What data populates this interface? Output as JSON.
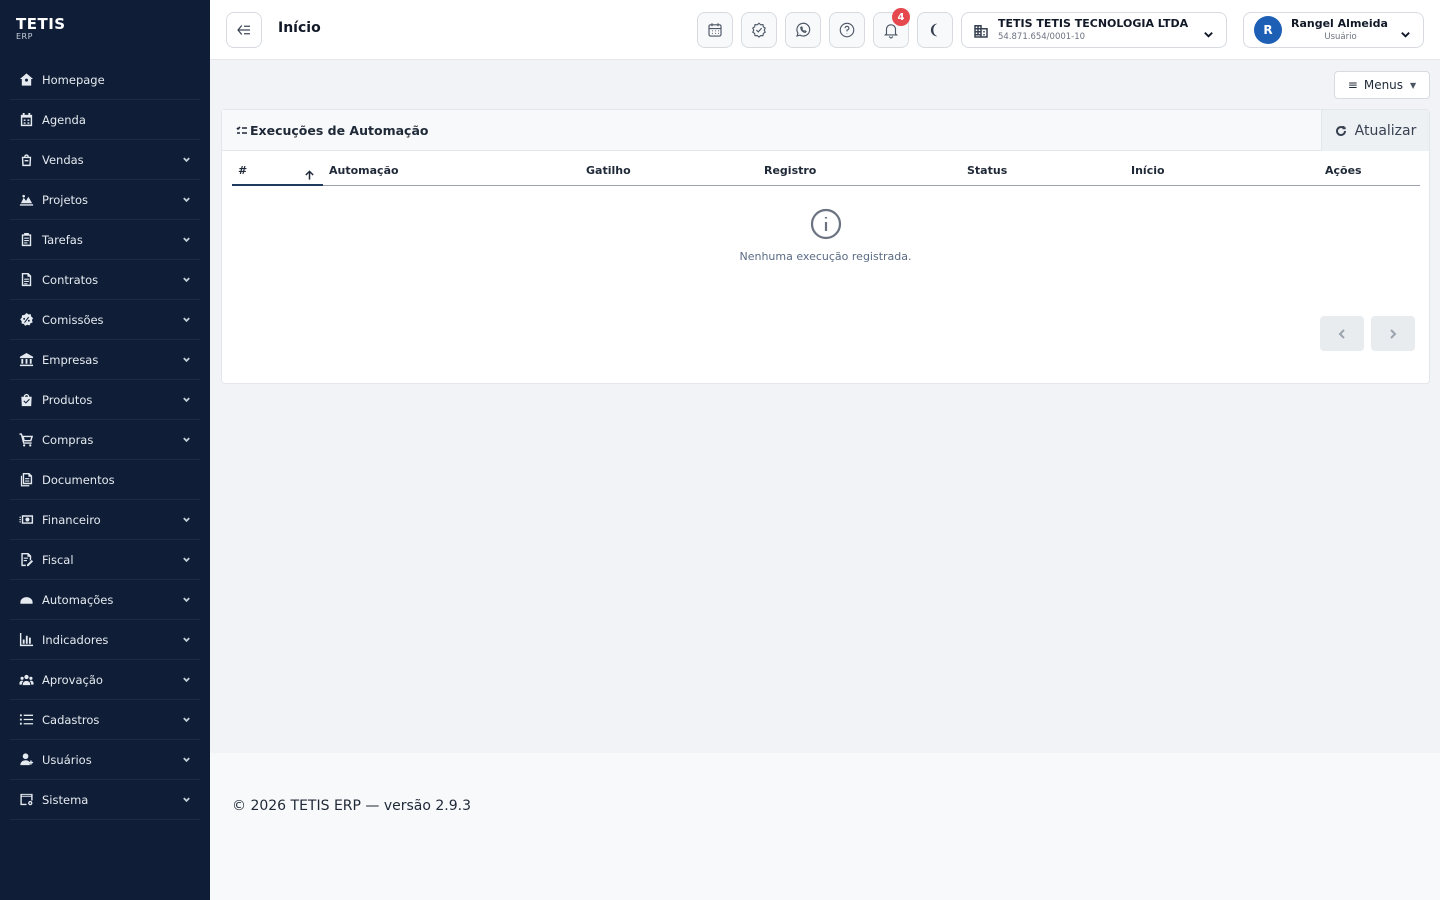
{
  "app": {
    "name": "TETIS",
    "subtitle": "ERP"
  },
  "sidebar": {
    "items": [
      {
        "label": "Homepage",
        "icon": "home-icon",
        "expandable": false
      },
      {
        "label": "Agenda",
        "icon": "calendar-icon",
        "expandable": false
      },
      {
        "label": "Vendas",
        "icon": "shopping-bag-icon",
        "expandable": true
      },
      {
        "label": "Projetos",
        "icon": "projects-icon",
        "expandable": true
      },
      {
        "label": "Tarefas",
        "icon": "clipboard-icon",
        "expandable": true
      },
      {
        "label": "Contratos",
        "icon": "document-icon",
        "expandable": true
      },
      {
        "label": "Comissões",
        "icon": "percent-badge-icon",
        "expandable": true
      },
      {
        "label": "Empresas",
        "icon": "bank-icon",
        "expandable": true
      },
      {
        "label": "Produtos",
        "icon": "product-bag-icon",
        "expandable": true
      },
      {
        "label": "Compras",
        "icon": "cart-icon",
        "expandable": true
      },
      {
        "label": "Documentos",
        "icon": "documents-icon",
        "expandable": false
      },
      {
        "label": "Financeiro",
        "icon": "money-icon",
        "expandable": true
      },
      {
        "label": "Fiscal",
        "icon": "fiscal-icon",
        "expandable": true
      },
      {
        "label": "Automações",
        "icon": "automation-icon",
        "expandable": true
      },
      {
        "label": "Indicadores",
        "icon": "chart-icon",
        "expandable": true
      },
      {
        "label": "Aprovação",
        "icon": "group-icon",
        "expandable": true
      },
      {
        "label": "Cadastros",
        "icon": "list-icon",
        "expandable": true
      },
      {
        "label": "Usuários",
        "icon": "user-icon",
        "expandable": true
      },
      {
        "label": "Sistema",
        "icon": "system-icon",
        "expandable": true
      }
    ]
  },
  "header": {
    "title": "Início",
    "notifications_count": "4",
    "company": {
      "name": "TETIS TETIS TECNOLOGIA LTDA",
      "cnpj": "54.871.654/0001-10"
    },
    "user": {
      "name": "Rangel Almeida",
      "role": "Usuário",
      "initial": "R"
    }
  },
  "toolbar": {
    "menus_label": "Menus"
  },
  "card": {
    "title": "Execuções de Automação",
    "refresh_label": "Atualizar",
    "columns": [
      "#",
      "Automação",
      "Gatilho",
      "Registro",
      "Status",
      "Início",
      "Ações"
    ],
    "empty_message": "Nenhuma execução registrada."
  },
  "footer": {
    "text": "© 2026 TETIS ERP — versão 2.9.3"
  },
  "colors": {
    "sidebar_bg": "#0f1e36",
    "badge": "#e5484d",
    "avatar": "#1d5fb4"
  }
}
